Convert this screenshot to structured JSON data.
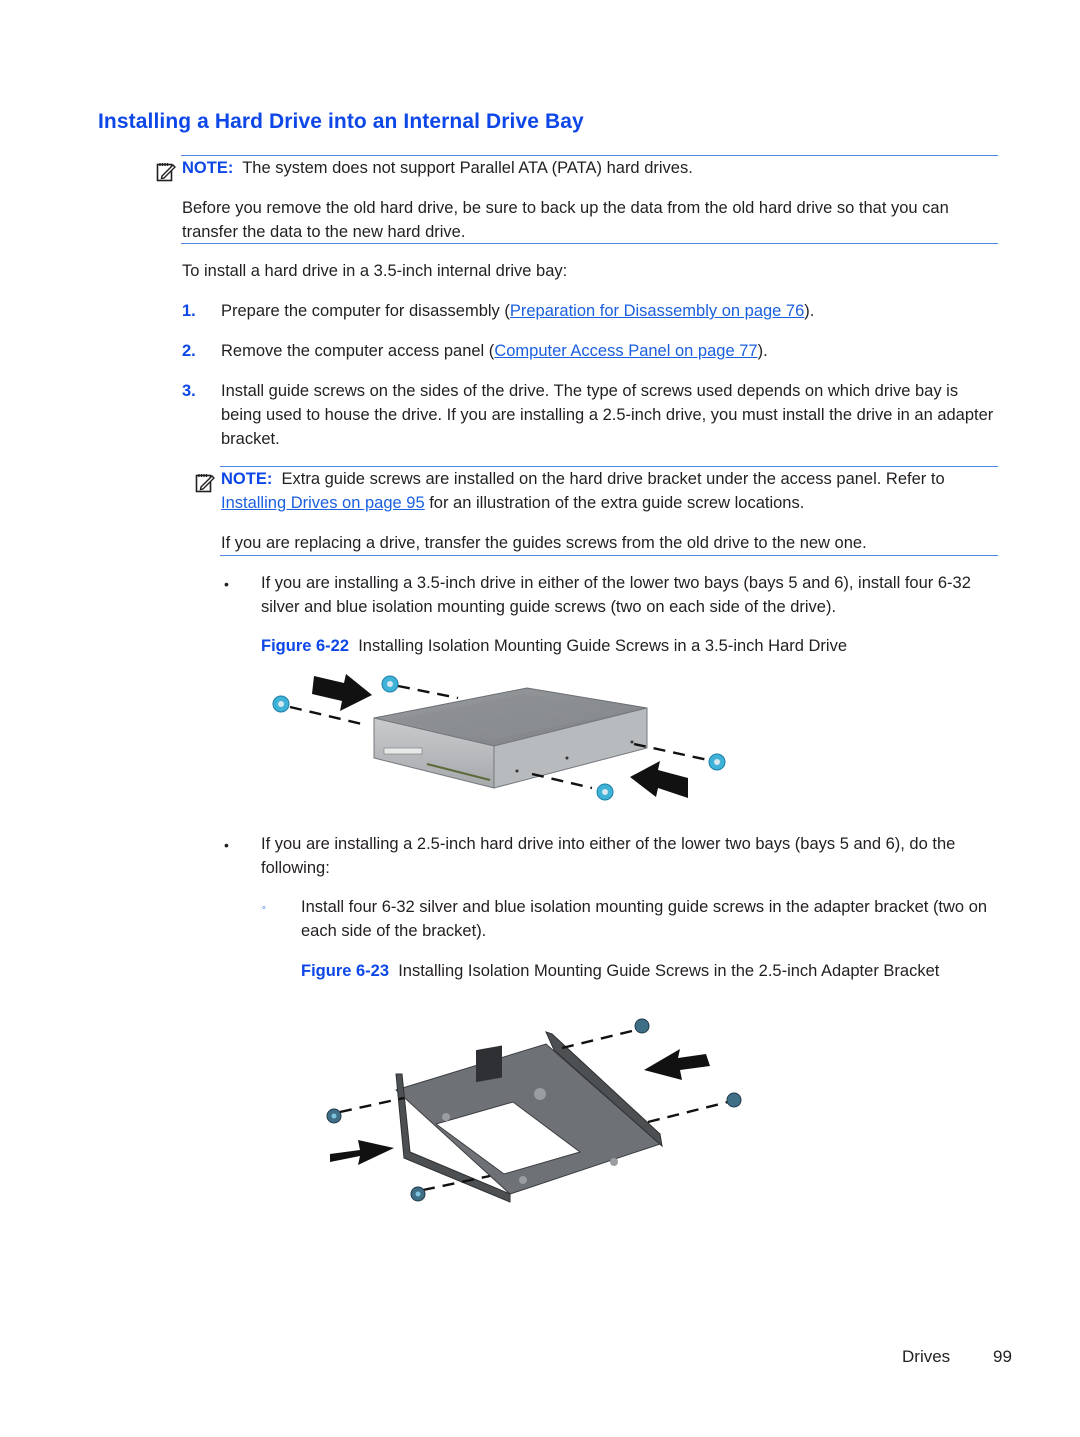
{
  "section_title": "Installing a Hard Drive into an Internal Drive Bay",
  "note1": {
    "icon": "note-pencil-icon",
    "label": "NOTE:",
    "text": "The system does not support Parallel ATA (PATA) hard drives."
  },
  "note1_para": "Before you remove the old hard drive, be sure to back up the data from the old hard drive so that you can transfer the data to the new hard drive.",
  "intro": "To install a hard drive in a 3.5-inch internal drive bay:",
  "steps": [
    {
      "number": "1.",
      "text_before": "Prepare the computer for disassembly (",
      "link": "Preparation for Disassembly on page 76",
      "text_after": ")."
    },
    {
      "number": "2.",
      "text_before": "Remove the computer access panel (",
      "link": "Computer Access Panel on page 77",
      "text_after": ")."
    },
    {
      "number": "3.",
      "text": "Install guide screws on the sides of the drive. The type of screws used depends on which drive bay is being used to house the drive. If you are installing a 2.5-inch drive, you must install the drive in an adapter bracket."
    }
  ],
  "note2": {
    "icon": "note-pencil-icon",
    "label": "NOTE:",
    "text_before": "Extra guide screws are installed on the hard drive bracket under the access panel. Refer to ",
    "link": "Installing Drives on page 95",
    "text_after": " for an illustration of the extra guide screw locations.",
    "para": "If you are replacing a drive, transfer the guides screws from the old drive to the new one."
  },
  "bullets": [
    {
      "symbol": "•",
      "text": "If you are installing a 3.5-inch drive in either of the lower two bays (bays 5 and 6), install four 6-32 silver and blue isolation mounting guide screws (two on each side of the drive).",
      "figure": {
        "label": "Figure 6-22",
        "caption": "Installing Isolation Mounting Guide Screws in a 3.5-inch Hard Drive"
      }
    },
    {
      "symbol": "•",
      "text": "If you are installing a 2.5-inch hard drive into either of the lower two bays (bays 5 and 6), do the following:",
      "sub": {
        "symbol": "◦",
        "text": "Install four 6-32 silver and blue isolation mounting guide screws in the adapter bracket (two on each side of the bracket).",
        "figure": {
          "label": "Figure 6-23",
          "caption": "Installing Isolation Mounting Guide Screws in the 2.5-inch Adapter Bracket"
        }
      }
    }
  ],
  "footer": {
    "section": "Drives",
    "page": "99"
  },
  "colors": {
    "heading_blue": "#0d47e8",
    "link_blue": "#1a5fe0",
    "rule_blue": "#4f86e8",
    "screw_blue": "#3fb2d8"
  }
}
